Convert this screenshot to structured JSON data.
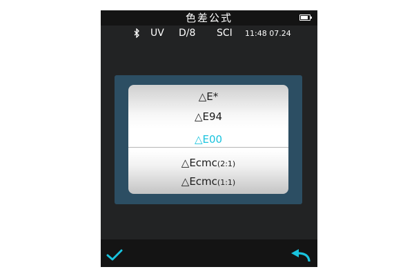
{
  "title_bar": {
    "title": "色差公式"
  },
  "status_bar": {
    "light_source": "UV",
    "geometry": "D/8",
    "mode": "SCI",
    "time_date": "11:48 07.24"
  },
  "formula_list": {
    "selected_index": 2,
    "options": [
      {
        "main": "△E*",
        "suffix": ""
      },
      {
        "main": "△E94",
        "suffix": ""
      },
      {
        "main": "△E00",
        "suffix": ""
      },
      {
        "main": "△Ecmc",
        "suffix": "(2:1)"
      },
      {
        "main": "△Ecmc",
        "suffix": "(1:1)"
      }
    ]
  },
  "icons": {
    "status": [
      "bluetooth-icon",
      "battery-icon"
    ],
    "bottom_bar": [
      "checkmark-icon",
      "back-arrow-icon"
    ]
  },
  "colors": {
    "accent": "#19c3de",
    "screen_bg": "#222324",
    "panel_bg": "#2c4e63"
  }
}
